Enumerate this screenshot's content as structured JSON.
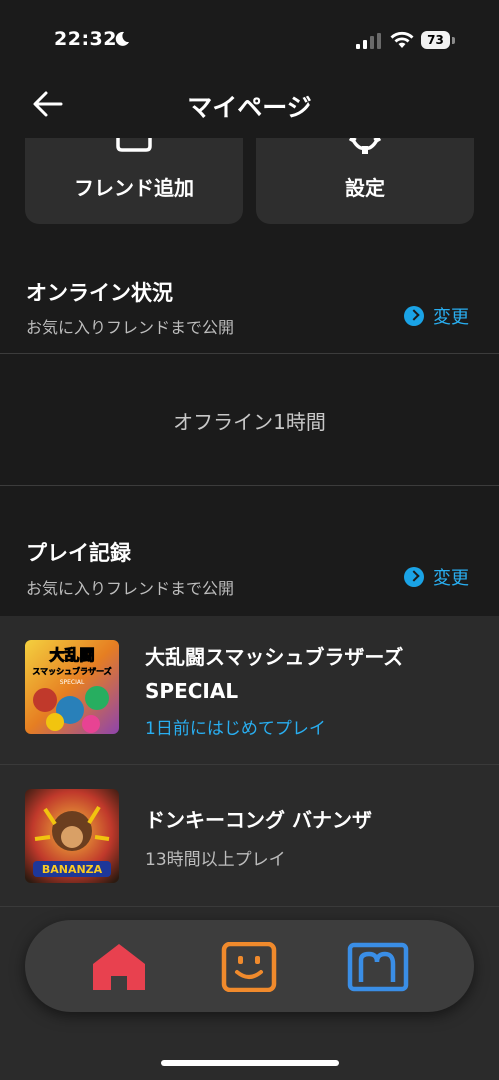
{
  "status_bar": {
    "time": "22:32",
    "battery": "73"
  },
  "header": {
    "title": "マイページ"
  },
  "cards": {
    "friend_add": "フレンド追加",
    "settings": "設定"
  },
  "online_status": {
    "title": "オンライン状況",
    "subtitle": "お気に入りフレンドまで公開",
    "change_label": "変更",
    "status_text": "オフライン1時間"
  },
  "play_record": {
    "title": "プレイ記録",
    "subtitle": "お気に入りフレンドまで公開",
    "change_label": "変更",
    "games": [
      {
        "title": "大乱闘スマッシュブラザーズ SPECIAL",
        "status": "1日前にはじめてプレイ",
        "status_color": "#29aef0",
        "thumb_text_1": "大乱闘",
        "thumb_text_2": "スマッシュブラザーズ",
        "thumb_text_3": "SPECIAL"
      },
      {
        "title": "ドンキーコング バナンザ",
        "status": "13時間以上プレイ",
        "status_color": "#bdbdbd",
        "thumb_text_1": "BANANZA"
      }
    ]
  },
  "bottom_nav": {
    "items": [
      {
        "icon": "home-icon",
        "color": "#e8414f"
      },
      {
        "icon": "friend-face-icon",
        "color": "#f08a2c"
      },
      {
        "icon": "news-icon",
        "color": "#3a8ee6"
      }
    ]
  },
  "colors": {
    "accent": "#29aef0",
    "background": "#1b1b1b",
    "card": "#2e2e2e"
  }
}
